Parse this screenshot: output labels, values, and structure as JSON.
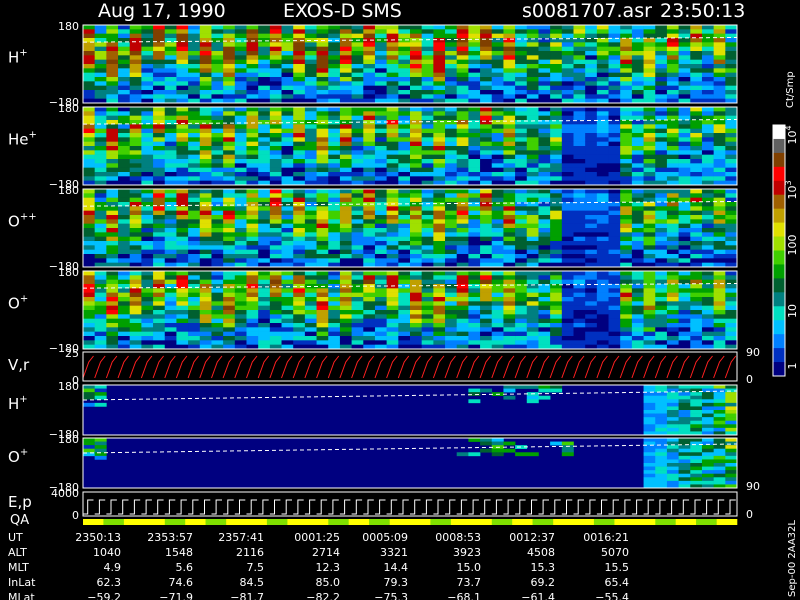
{
  "header": {
    "date": "Aug 17, 1990",
    "instrument": "EXOS-D SMS",
    "file": "s0081707.asr",
    "time": "23:50:13"
  },
  "colorbar": {
    "unit": "Ct/Smp",
    "ticks": [
      "1",
      "10",
      "100",
      "10",
      "10"
    ],
    "tick_exponents": [
      "",
      "",
      "",
      "3",
      "4"
    ],
    "colors": [
      "#000080",
      "#0030c0",
      "#0080ff",
      "#00c0ff",
      "#00e0c0",
      "#008080",
      "#006030",
      "#00a000",
      "#40d000",
      "#a0e000",
      "#e0e000",
      "#c0a000",
      "#a06000",
      "#c00000",
      "#ff0000",
      "#804000",
      "#606060",
      "#ffffff"
    ]
  },
  "chart_data": {
    "type": "heatmap",
    "panels": [
      {
        "species": "H",
        "charge": "+",
        "ymax_label": "180",
        "ymin_label": "−180"
      },
      {
        "species": "He",
        "charge": "+",
        "ymax_label": "180",
        "ymin_label": "−180"
      },
      {
        "species": "O",
        "charge": "++",
        "ymax_label": "180",
        "ymin_label": "−180"
      },
      {
        "species": "O",
        "charge": "+",
        "ymax_label": "180",
        "ymin_label": "−180"
      },
      {
        "species": "V,r",
        "charge": "",
        "ymax_label": "25",
        "ymin_label": "0",
        "right_top": "90",
        "right_bottom": "0"
      },
      {
        "species": "H",
        "charge": "+",
        "ymax_label": "180",
        "ymin_label": "−180"
      },
      {
        "species": "O",
        "charge": "+",
        "ymax_label": "180",
        "ymin_label": "−180",
        "right_bottom": "90"
      },
      {
        "species": "E,p",
        "charge": "",
        "ymax_label": "4000",
        "ymin_label": "0",
        "right_bottom": "0"
      }
    ],
    "qa_label": "QA",
    "x_rows": [
      {
        "label": "UT",
        "values": [
          "2350:13",
          "2353:57",
          "2357:41",
          "0001:25",
          "0005:09",
          "0008:53",
          "0012:37",
          "0016:21"
        ]
      },
      {
        "label": "ALT",
        "values": [
          "1040",
          "1548",
          "2116",
          "2714",
          "3321",
          "3923",
          "4508",
          "5070"
        ]
      },
      {
        "label": "MLT",
        "values": [
          "4.9",
          "5.6",
          "7.5",
          "12.3",
          "14.4",
          "15.0",
          "15.3",
          "15.5"
        ]
      },
      {
        "label": "InLat",
        "values": [
          "62.3",
          "74.6",
          "84.5",
          "85.0",
          "79.3",
          "73.7",
          "69.2",
          "65.4"
        ]
      },
      {
        "label": "MLat",
        "values": [
          "−59.2",
          "−71.9",
          "−81.7",
          "−82.2",
          "−75.3",
          "−68.1",
          "−61.4",
          "−55.4"
        ]
      }
    ],
    "footer_note": "Sep-00  2AA32L"
  }
}
